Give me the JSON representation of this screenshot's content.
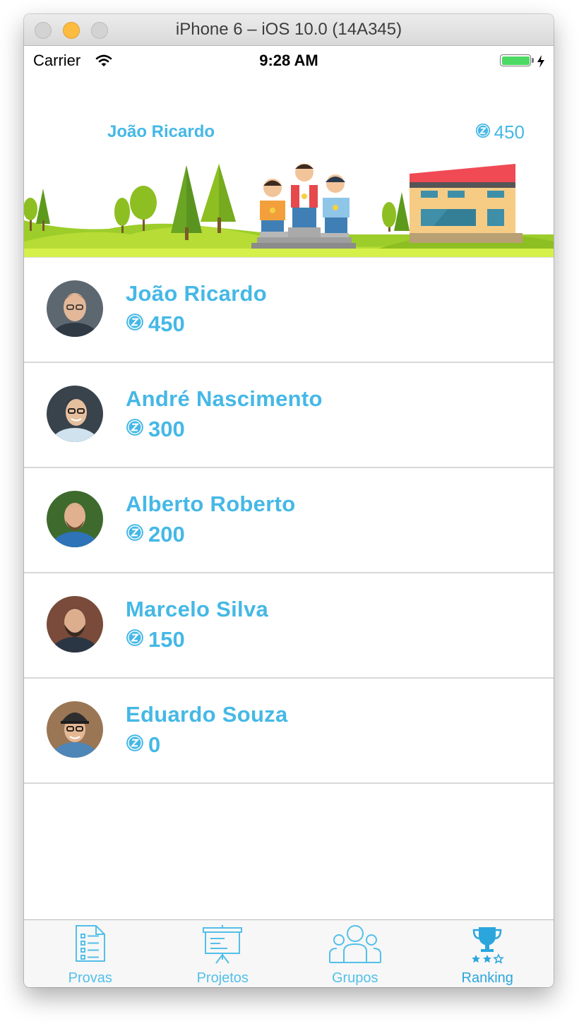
{
  "window": {
    "title": "iPhone 6 – iOS 10.0 (14A345)"
  },
  "status_bar": {
    "carrier": "Carrier",
    "time": "9:28 AM"
  },
  "header": {
    "user_name": "João Ricardo",
    "points": "450"
  },
  "ranking": [
    {
      "name": "João Ricardo",
      "points": "450"
    },
    {
      "name": "André Nascimento",
      "points": "300"
    },
    {
      "name": "Alberto Roberto",
      "points": "200"
    },
    {
      "name": "Marcelo Silva",
      "points": "150"
    },
    {
      "name": "Eduardo Souza",
      "points": "0"
    }
  ],
  "tabs": [
    {
      "label": "Provas",
      "icon": "checklist-icon",
      "active": false
    },
    {
      "label": "Projetos",
      "icon": "presentation-board-icon",
      "active": false
    },
    {
      "label": "Grupos",
      "icon": "group-icon",
      "active": false
    },
    {
      "label": "Ranking",
      "icon": "trophy-icon",
      "active": true
    }
  ],
  "colors": {
    "accent": "#45b8e6",
    "tab_active": "#2aa6dd",
    "battery": "#4cd964",
    "minimize_button": "#fdbc40"
  }
}
